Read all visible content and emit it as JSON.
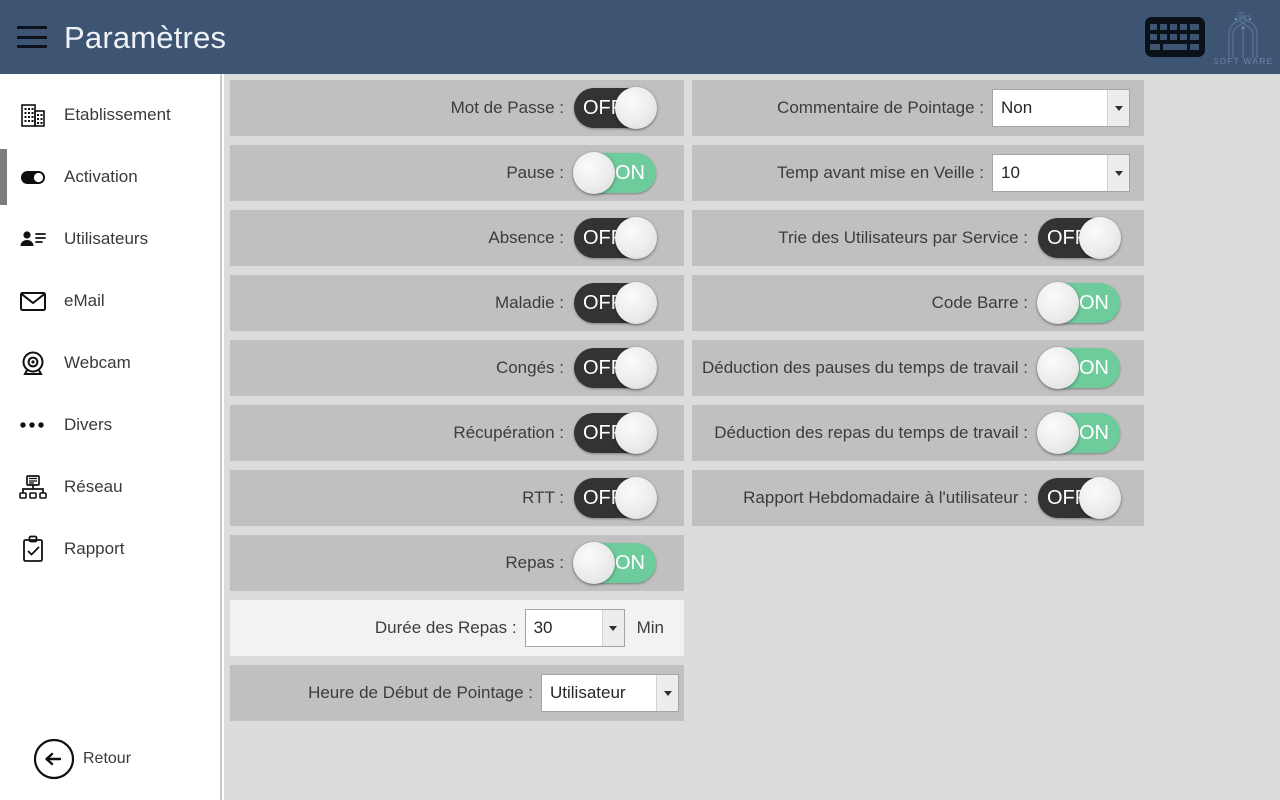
{
  "header": {
    "title": "Paramètres",
    "menu_icon": "hamburger-menu-icon",
    "keyboard_icon": "keyboard-icon",
    "logo_text": "SOFT WARE",
    "background_color": "#3d5472"
  },
  "sidebar": {
    "items": [
      {
        "label": "Etablissement",
        "icon": "building-icon",
        "active": false
      },
      {
        "label": "Activation",
        "icon": "toggle-icon",
        "active": true
      },
      {
        "label": "Utilisateurs",
        "icon": "users-icon",
        "active": false
      },
      {
        "label": "eMail",
        "icon": "envelope-icon",
        "active": false
      },
      {
        "label": "Webcam",
        "icon": "webcam-icon",
        "active": false
      },
      {
        "label": "Divers",
        "icon": "ellipsis-icon",
        "active": false
      },
      {
        "label": "Réseau",
        "icon": "network-icon",
        "active": false
      },
      {
        "label": "Rapport",
        "icon": "clipboard-check-icon",
        "active": false
      }
    ],
    "back": {
      "label": "Retour",
      "icon": "arrow-left-circle-icon"
    }
  },
  "main": {
    "left_column": [
      {
        "label": "Mot de Passe :",
        "type": "toggle",
        "value": "OFF"
      },
      {
        "label": "Pause :",
        "type": "toggle",
        "value": "ON"
      },
      {
        "label": "Absence :",
        "type": "toggle",
        "value": "OFF"
      },
      {
        "label": "Maladie :",
        "type": "toggle",
        "value": "OFF"
      },
      {
        "label": "Congés :",
        "type": "toggle",
        "value": "OFF"
      },
      {
        "label": "Récupération :",
        "type": "toggle",
        "value": "OFF"
      },
      {
        "label": "RTT :",
        "type": "toggle",
        "value": "OFF"
      },
      {
        "label": "Repas :",
        "type": "toggle",
        "value": "ON"
      },
      {
        "label": "Durée des Repas :",
        "type": "select",
        "value": "30",
        "unit": "Min"
      },
      {
        "label": "Heure de Début de Pointage :",
        "type": "select",
        "value": "Utilisateur"
      }
    ],
    "right_column": [
      {
        "label": "Commentaire de Pointage :",
        "type": "select",
        "value": "Non"
      },
      {
        "label": "Temp avant mise en Veille :",
        "type": "select",
        "value": "10"
      },
      {
        "label": "Trie des Utilisateurs par Service :",
        "type": "toggle",
        "value": "OFF"
      },
      {
        "label": "Code Barre :",
        "type": "toggle",
        "value": "ON"
      },
      {
        "label": "Déduction des pauses du temps de travail :",
        "type": "toggle",
        "value": "ON"
      },
      {
        "label": "Déduction des repas du temps de travail :",
        "type": "toggle",
        "value": "ON"
      },
      {
        "label": "Rapport Hebdomadaire à l'utilisateur :",
        "type": "toggle",
        "value": "OFF"
      }
    ],
    "toggle_on_label": "ON",
    "toggle_off_label": "OFF",
    "colors": {
      "row": "#c0c0c0",
      "row_light": "#f2f2f2",
      "background": "#dcdcdc",
      "on": "#6ecb9b",
      "off": "#333333"
    }
  }
}
